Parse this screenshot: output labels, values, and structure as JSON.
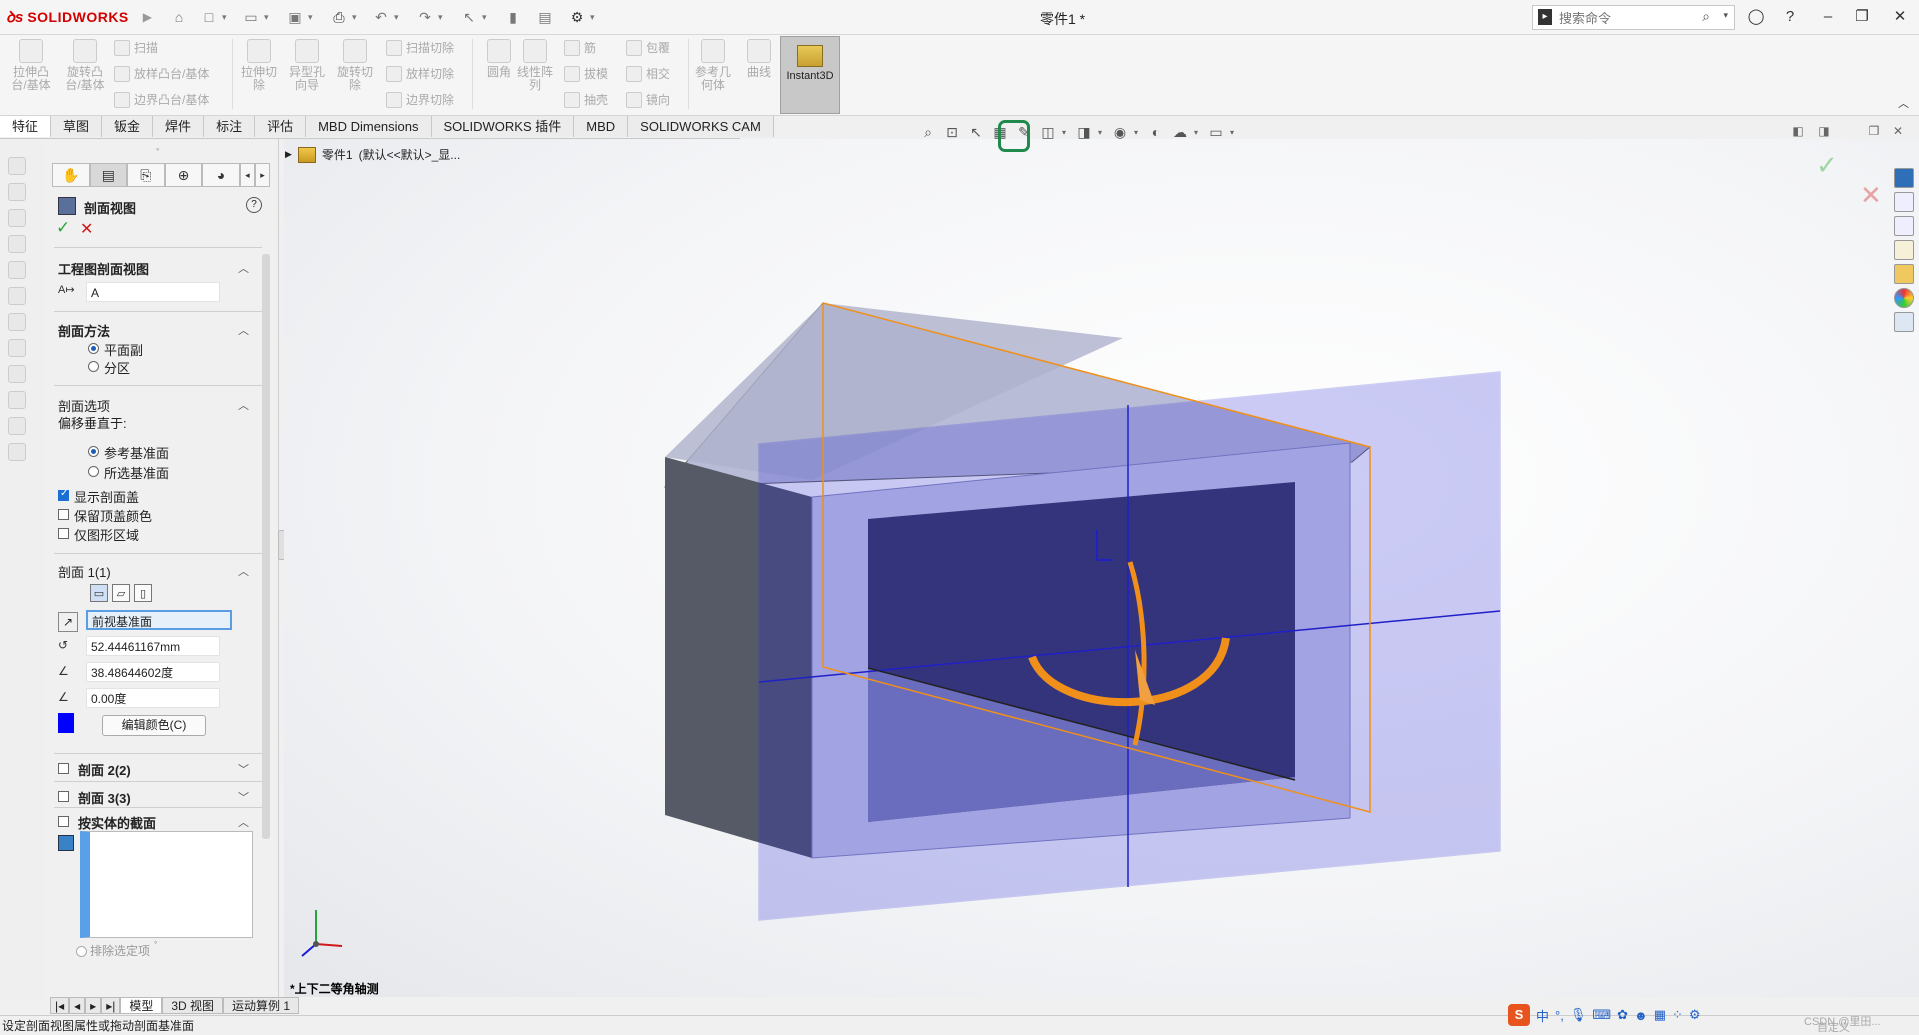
{
  "app": {
    "brand": "SOLIDWORKS",
    "document_title": "零件1 *",
    "search_placeholder": "搜索命令"
  },
  "ribbon": {
    "groups": [
      {
        "label": "拉伸凸\n台/基体"
      },
      {
        "label": "旋转凸\n台/基体"
      },
      {
        "label": "扫描"
      },
      {
        "label": "放样凸台/基体"
      },
      {
        "label": "边界凸台/基体"
      },
      {
        "label": "拉伸切\n除"
      },
      {
        "label": "异型孔\n向导"
      },
      {
        "label": "旋转切\n除"
      },
      {
        "label": "扫描切除"
      },
      {
        "label": "放样切除"
      },
      {
        "label": "边界切除"
      },
      {
        "label": "圆角"
      },
      {
        "label": "线性阵\n列"
      },
      {
        "label": "筋"
      },
      {
        "label": "拔模"
      },
      {
        "label": "抽壳"
      },
      {
        "label": "包覆"
      },
      {
        "label": "相交"
      },
      {
        "label": "镜向"
      },
      {
        "label": "参考几\n何体"
      },
      {
        "label": "曲线"
      }
    ],
    "instant3d": "Instant3D"
  },
  "tabs": [
    "特征",
    "草图",
    "钣金",
    "焊件",
    "标注",
    "评估",
    "MBD Dimensions",
    "SOLIDWORKS 插件",
    "MBD",
    "SOLIDWORKS CAM"
  ],
  "feature_tree": {
    "item": "零件1",
    "config": "(默认<<默认>_显..."
  },
  "property_manager": {
    "title": "剖面视图",
    "section_drawing": {
      "title": "工程图剖面视图",
      "value": "A"
    },
    "section_method": {
      "title": "剖面方法",
      "options": [
        "平面副",
        "分区"
      ],
      "selected": 0
    },
    "section_options": {
      "title": "剖面选项",
      "offset_label": "偏移垂直于:",
      "offset_options": [
        "参考基准面",
        "所选基准面"
      ],
      "offset_selected": 0,
      "checkboxes": [
        {
          "label": "显示剖面盖",
          "checked": true
        },
        {
          "label": "保留顶盖颜色",
          "checked": false
        },
        {
          "label": "仅图形区域",
          "checked": false
        }
      ]
    },
    "section1": {
      "title": "剖面 1(1)",
      "plane": "前视基准面",
      "distance": "52.44461167mm",
      "angle1": "38.48644602度",
      "angle2": "0.00度",
      "edit_color": "编辑颜色(C)",
      "color": "#0000ff"
    },
    "section2": {
      "title": "剖面 2(2)"
    },
    "section3": {
      "title": "剖面 3(3)"
    },
    "by_body": {
      "title": "按实体的截面",
      "exclude": "排除选定项"
    }
  },
  "viewport": {
    "view_name": "*上下二等角轴测"
  },
  "bottom_tabs": [
    "模型",
    "3D 视图",
    "运动算例 1"
  ],
  "status": {
    "message": "设定剖面视图属性或拖动剖面基准面",
    "custom": "自定义",
    "watermark": "CSDN @里田..."
  },
  "ime": {
    "logo": "S",
    "lang": "中"
  },
  "colors": {
    "brand": "#d40000",
    "section_plane": "#0000ff",
    "selection_orange": "#f0901a",
    "body_dark": "#555a66",
    "confirm_green": "#2aa43a",
    "cancel_red": "#d01818"
  }
}
